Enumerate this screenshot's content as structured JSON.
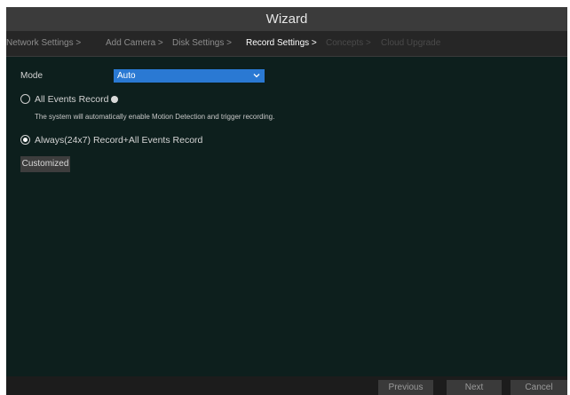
{
  "window": {
    "title": "Wizard"
  },
  "steps": [
    {
      "label": "Network Settings >",
      "state": "done"
    },
    {
      "label": "Add Camera >",
      "state": "done"
    },
    {
      "label": "Disk Settings >",
      "state": "done"
    },
    {
      "label": "Record Settings >",
      "state": "active"
    },
    {
      "label": "Concepts >",
      "state": "pending"
    },
    {
      "label": "Cloud Upgrade",
      "state": "pending"
    }
  ],
  "mode": {
    "label": "Mode",
    "value": "Auto"
  },
  "options": {
    "all_events": {
      "label": "All Events Record",
      "selected": false
    },
    "description": "The system will automatically enable Motion Detection and trigger recording.",
    "always": {
      "label": "Always(24x7) Record+All Events Record",
      "selected": true
    }
  },
  "customized_label": "Customized",
  "footer": {
    "previous_label": "Previous",
    "next_label": "Next",
    "cancel_label": "Cancel"
  },
  "colors": {
    "background": "#0d1f1d",
    "titlebar": "#3b3b3b",
    "accent": "#2a79d3"
  }
}
